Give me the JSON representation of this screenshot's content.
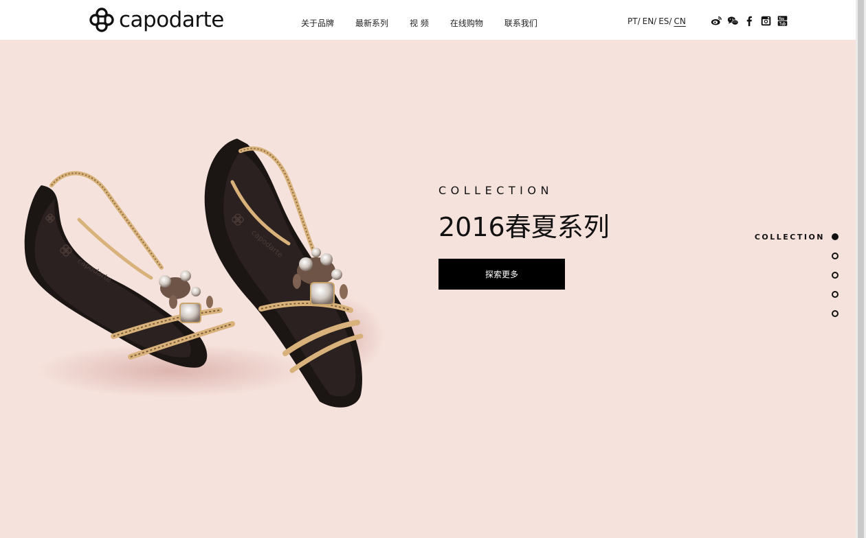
{
  "brand": {
    "name": "capodarte"
  },
  "nav": {
    "items": [
      {
        "label": "关于品牌"
      },
      {
        "label": "最新系列"
      },
      {
        "label": "视 频"
      },
      {
        "label": "在线购物"
      },
      {
        "label": "联系我们"
      }
    ]
  },
  "languages": {
    "items": [
      {
        "label": "PT/",
        "active": false
      },
      {
        "label": "EN/",
        "active": false
      },
      {
        "label": "ES/",
        "active": false
      },
      {
        "label": "CN",
        "active": true
      }
    ]
  },
  "social": {
    "icons": [
      "weibo-icon",
      "wechat-icon",
      "facebook-icon",
      "instagram-icon",
      "youtube-icon"
    ]
  },
  "hero": {
    "collection_label": "COLLECTION",
    "title": "2016春夏系列",
    "button_label": "探索更多",
    "image_brand_text": "capodarte"
  },
  "side_nav": {
    "active_label": "COLLECTION",
    "dot_count": 5,
    "active_index": 0
  },
  "colors": {
    "background": "#f6e2dc",
    "header": "#ffffff",
    "button": "#000000",
    "text": "#111111"
  }
}
